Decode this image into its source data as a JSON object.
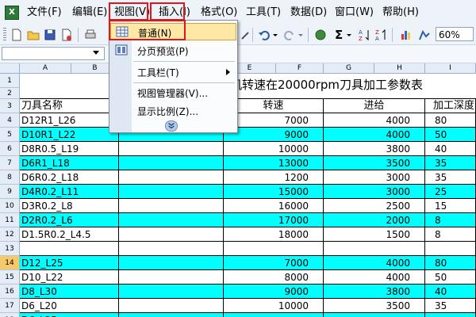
{
  "menubar": {
    "items": [
      {
        "label": "文件(F)"
      },
      {
        "label": "编辑(E)"
      },
      {
        "label": "视图(V)"
      },
      {
        "label": "插入(I)"
      },
      {
        "label": "格式(O)"
      },
      {
        "label": "工具(T)"
      },
      {
        "label": "数据(D)"
      },
      {
        "label": "窗口(W)"
      },
      {
        "label": "帮助(H)"
      }
    ]
  },
  "toolbar": {
    "zoom": "60%",
    "sigma": "Σ"
  },
  "view_menu": {
    "items": [
      {
        "label": "普通(N)",
        "icon": "normal-view-icon"
      },
      {
        "label": "分页预览(P)",
        "icon": "page-break-preview-icon"
      },
      {
        "label": "工具栏(T)",
        "icon": ""
      },
      {
        "label": "视图管理器(V)...",
        "icon": ""
      },
      {
        "label": "显示比例(Z)...",
        "icon": ""
      }
    ],
    "expand_icon": "chevron-double-down-icon"
  },
  "sheet": {
    "columns": [
      "A",
      "B",
      "E",
      "F",
      "G",
      "H",
      "I"
    ],
    "title": "机转速在20000rpm刀具加工参数表",
    "header": {
      "name": "刀具名称",
      "speed": "转速",
      "feed": "进给",
      "depth": "加工深度"
    },
    "rows": [
      {
        "num": "1",
        "name": "",
        "speed": "",
        "feed": "",
        "depth": "",
        "cyan": false
      },
      {
        "num": "2",
        "name": "",
        "speed": "",
        "feed": "",
        "depth": "",
        "cyan": false
      },
      {
        "num": "3",
        "name": "",
        "speed": "",
        "feed": "",
        "depth": "",
        "cyan": false
      },
      {
        "num": "4",
        "name": "D12R1_L26",
        "speed": "7000",
        "feed": "4000",
        "depth": "80",
        "cyan": false
      },
      {
        "num": "5",
        "name": "D10R1_L22",
        "speed": "9000",
        "feed": "4000",
        "depth": "50",
        "cyan": true
      },
      {
        "num": "6",
        "name": "D8R0.5_L19",
        "speed": "10000",
        "feed": "3800",
        "depth": "40",
        "cyan": false
      },
      {
        "num": "7",
        "name": "D6R1_L18",
        "speed": "13000",
        "feed": "3500",
        "depth": "35",
        "cyan": true
      },
      {
        "num": "8",
        "name": "D6R0.2_L18",
        "speed": "1200",
        "feed": "3000",
        "depth": "35",
        "cyan": false
      },
      {
        "num": "9",
        "name": "D4R0.2_L11",
        "speed": "15000",
        "feed": "3000",
        "depth": "25",
        "cyan": true
      },
      {
        "num": "10",
        "name": "D3R0.2_L8",
        "speed": "16000",
        "feed": "2500",
        "depth": "15",
        "cyan": false
      },
      {
        "num": "11",
        "name": "D2R0.2_L6",
        "speed": "17000",
        "feed": "2000",
        "depth": "8",
        "cyan": true
      },
      {
        "num": "12",
        "name": "D1.5R0.2_L4.5",
        "speed": "18000",
        "feed": "1500",
        "depth": "8",
        "cyan": false
      },
      {
        "num": "13",
        "name": "",
        "speed": "",
        "feed": "",
        "depth": "",
        "cyan": false
      },
      {
        "num": "14",
        "name": "D12_L25",
        "speed": "7000",
        "feed": "4000",
        "depth": "80",
        "cyan": true
      },
      {
        "num": "15",
        "name": "D10_L22",
        "speed": "8000",
        "feed": "4000",
        "depth": "50",
        "cyan": false
      },
      {
        "num": "16",
        "name": "D8_L30",
        "speed": "9000",
        "feed": "3800",
        "depth": "40",
        "cyan": true
      },
      {
        "num": "17",
        "name": "D6_L20",
        "speed": "10000",
        "feed": "3500",
        "depth": "35",
        "cyan": false
      },
      {
        "num": "18",
        "name": "D6_L25",
        "speed": "",
        "feed": "",
        "depth": "",
        "cyan": true
      }
    ]
  }
}
